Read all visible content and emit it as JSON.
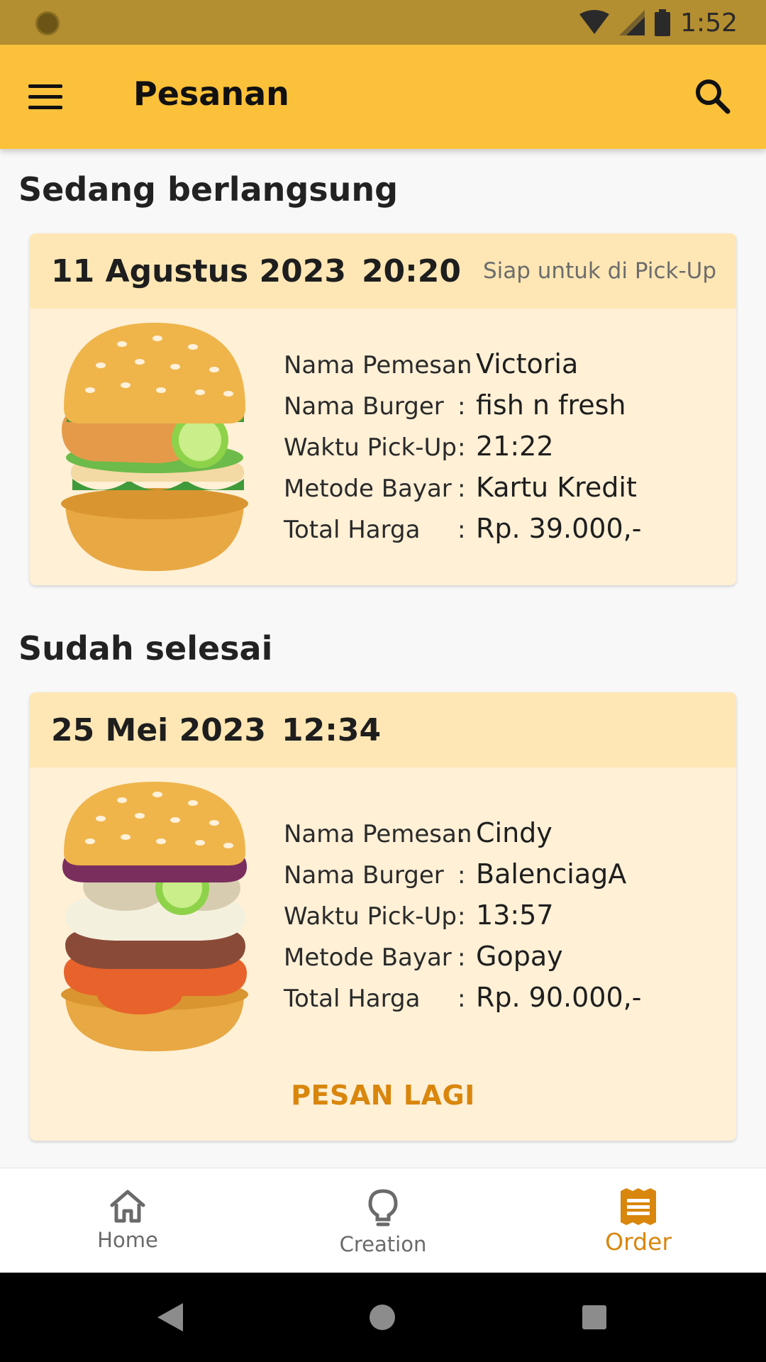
{
  "status_bar": {
    "time": "1:52"
  },
  "app_bar": {
    "title": "Pesanan"
  },
  "ongoing": {
    "section_title": "Sedang berlangsung",
    "date": "11 Agustus 2023",
    "time": "20:20",
    "status": "Siap untuk di Pick-Up",
    "rows": [
      {
        "label": "Nama Pemesan",
        "value": "Victoria"
      },
      {
        "label": "Nama Burger",
        "value": "fish n fresh"
      },
      {
        "label": "Waktu Pick-Up",
        "value": "21:22"
      },
      {
        "label": "Metode Bayar",
        "value": "Kartu Kredit"
      },
      {
        "label": "Total Harga",
        "value": "Rp. 39.000,-"
      }
    ]
  },
  "completed": {
    "section_title": "Sudah selesai",
    "date": "25 Mei 2023",
    "time": "12:34",
    "rows": [
      {
        "label": "Nama Pemesan",
        "value": "Cindy"
      },
      {
        "label": "Nama Burger",
        "value": "BalenciagA"
      },
      {
        "label": "Waktu Pick-Up",
        "value": "13:57"
      },
      {
        "label": "Metode Bayar",
        "value": "Gopay"
      },
      {
        "label": "Total Harga",
        "value": "Rp. 90.000,-"
      }
    ],
    "reorder_label": "PESAN LAGI"
  },
  "separator": ":",
  "bottom_nav": {
    "items": [
      {
        "label": "Home",
        "icon": "home-icon"
      },
      {
        "label": "Creation",
        "icon": "lightbulb-icon"
      },
      {
        "label": "Order",
        "icon": "receipt-icon",
        "active": true
      }
    ]
  },
  "colors": {
    "accent": "#FBC13A",
    "status_bar": "#B48F31",
    "card_bg": "#FFF0D6",
    "card_header": "#FFE7B5",
    "active": "#D9860D"
  }
}
